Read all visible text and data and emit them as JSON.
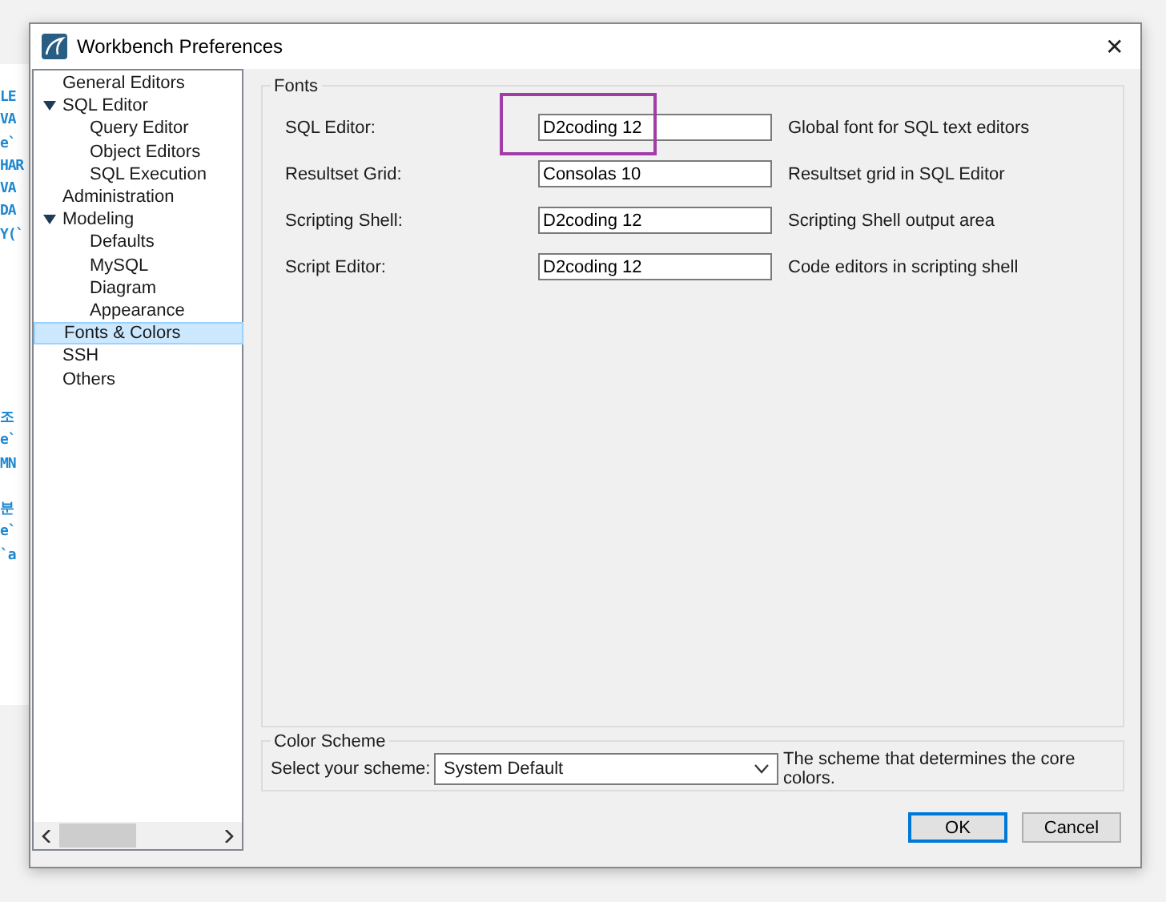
{
  "background_editor": {
    "blocks": [
      {
        "lines": [
          "LE",
          "VA",
          "e`",
          "HAR",
          "VA",
          "DA",
          "Y(`"
        ]
      },
      {
        "lines": [
          "조",
          "e`",
          "MN"
        ]
      },
      {
        "lines": [
          "분",
          "e`",
          "`a"
        ]
      }
    ]
  },
  "window": {
    "title": "Workbench Preferences",
    "close": "✕"
  },
  "sidebar": {
    "items": [
      {
        "label": "General Editors",
        "selected": false
      },
      {
        "label": "SQL Editor",
        "selected": false,
        "expanded": true,
        "children": [
          {
            "label": "Query Editor",
            "selected": false
          },
          {
            "label": "Object Editors",
            "selected": false
          },
          {
            "label": "SQL Execution",
            "selected": false
          }
        ]
      },
      {
        "label": "Administration",
        "selected": false
      },
      {
        "label": "Modeling",
        "selected": false,
        "expanded": true,
        "children": [
          {
            "label": "Defaults",
            "selected": false
          },
          {
            "label": "MySQL",
            "selected": false
          },
          {
            "label": "Diagram",
            "selected": false
          },
          {
            "label": "Appearance",
            "selected": false
          }
        ]
      },
      {
        "label": "Fonts & Colors",
        "selected": true
      },
      {
        "label": "SSH",
        "selected": false
      },
      {
        "label": "Others",
        "selected": false
      }
    ]
  },
  "fonts": {
    "title": "Fonts",
    "rows": [
      {
        "label": "SQL Editor:",
        "value": "D2coding 12",
        "description": "Global font for SQL text editors",
        "highlighted": true
      },
      {
        "label": "Resultset Grid:",
        "value": "Consolas 10",
        "description": "Resultset grid in SQL Editor",
        "highlighted": false
      },
      {
        "label": "Scripting Shell:",
        "value": "D2coding 12",
        "description": "Scripting Shell output area",
        "highlighted": false
      },
      {
        "label": "Script Editor:",
        "value": "D2coding 12",
        "description": "Code editors in scripting shell",
        "highlighted": false
      }
    ]
  },
  "color_scheme": {
    "title": "Color Scheme",
    "label": "Select your scheme:",
    "value": "System Default",
    "description": "The scheme that determines the core colors."
  },
  "buttons": [
    {
      "label": "OK",
      "default": true
    },
    {
      "label": "Cancel",
      "default": false
    }
  ]
}
